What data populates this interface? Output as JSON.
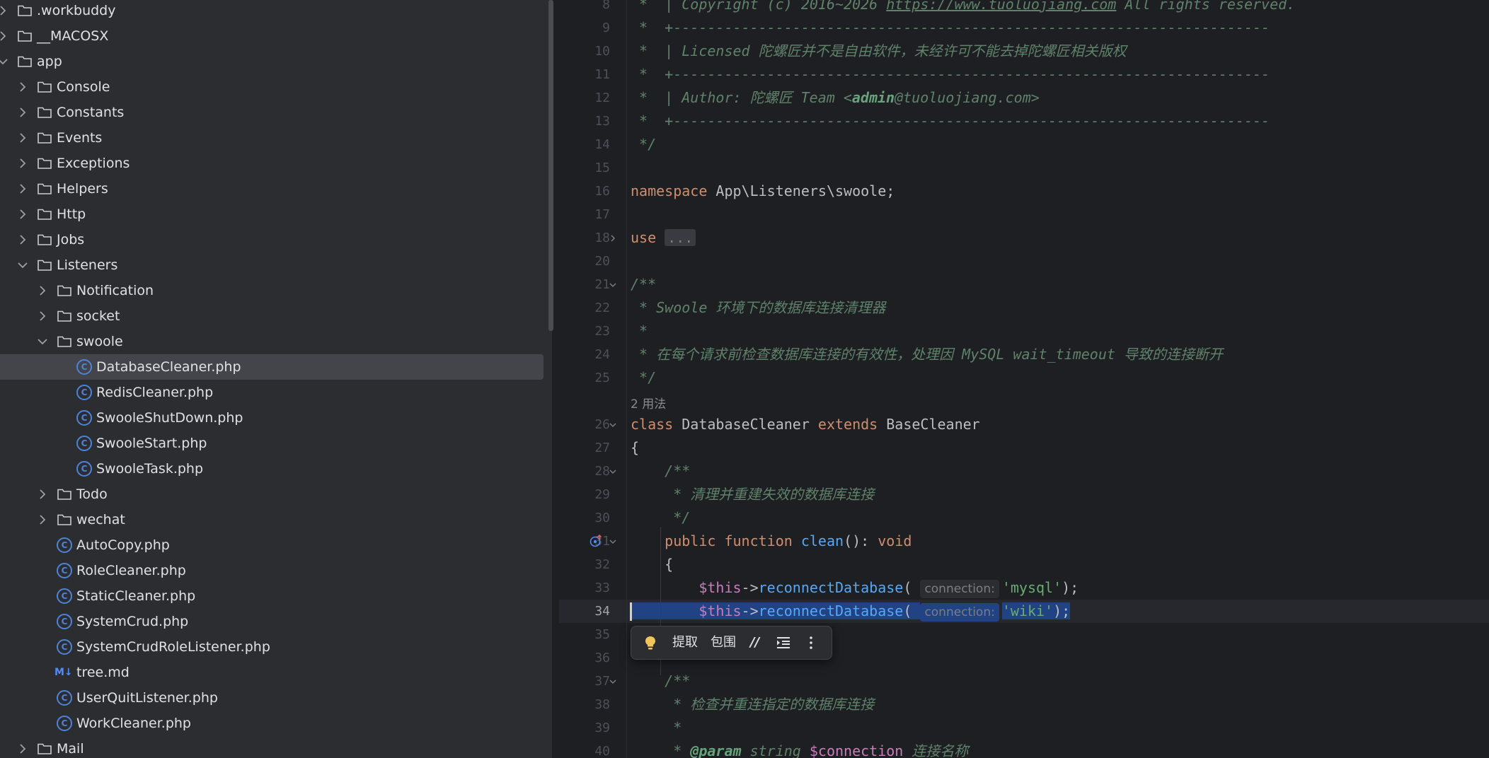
{
  "project_tree": {
    "items": [
      {
        "label": ".workbuddy",
        "type": "folder",
        "expanded": false,
        "depth": 0
      },
      {
        "label": "__MACOSX",
        "type": "folder",
        "expanded": false,
        "depth": 0
      },
      {
        "label": "app",
        "type": "folder",
        "expanded": true,
        "depth": 0
      },
      {
        "label": "Console",
        "type": "folder",
        "expanded": false,
        "depth": 1
      },
      {
        "label": "Constants",
        "type": "folder",
        "expanded": false,
        "depth": 1
      },
      {
        "label": "Events",
        "type": "folder",
        "expanded": false,
        "depth": 1
      },
      {
        "label": "Exceptions",
        "type": "folder",
        "expanded": false,
        "depth": 1
      },
      {
        "label": "Helpers",
        "type": "folder",
        "expanded": false,
        "depth": 1
      },
      {
        "label": "Http",
        "type": "folder",
        "expanded": false,
        "depth": 1
      },
      {
        "label": "Jobs",
        "type": "folder",
        "expanded": false,
        "depth": 1
      },
      {
        "label": "Listeners",
        "type": "folder",
        "expanded": true,
        "depth": 1
      },
      {
        "label": "Notification",
        "type": "folder",
        "expanded": false,
        "depth": 2
      },
      {
        "label": "socket",
        "type": "folder",
        "expanded": false,
        "depth": 2
      },
      {
        "label": "swoole",
        "type": "folder",
        "expanded": true,
        "depth": 2
      },
      {
        "label": "DatabaseCleaner.php",
        "type": "class",
        "depth": 3,
        "selected": true
      },
      {
        "label": "RedisCleaner.php",
        "type": "class",
        "depth": 3
      },
      {
        "label": "SwooleShutDown.php",
        "type": "class",
        "depth": 3
      },
      {
        "label": "SwooleStart.php",
        "type": "class",
        "depth": 3
      },
      {
        "label": "SwooleTask.php",
        "type": "class",
        "depth": 3
      },
      {
        "label": "Todo",
        "type": "folder",
        "expanded": false,
        "depth": 2
      },
      {
        "label": "wechat",
        "type": "folder",
        "expanded": false,
        "depth": 2
      },
      {
        "label": "AutoCopy.php",
        "type": "class",
        "depth": 2
      },
      {
        "label": "RoleCleaner.php",
        "type": "class",
        "depth": 2
      },
      {
        "label": "StaticCleaner.php",
        "type": "class",
        "depth": 2
      },
      {
        "label": "SystemCrud.php",
        "type": "class",
        "depth": 2
      },
      {
        "label": "SystemCrudRoleListener.php",
        "type": "class",
        "depth": 2
      },
      {
        "label": "tree.md",
        "type": "markdown",
        "depth": 2
      },
      {
        "label": "UserQuitListener.php",
        "type": "class",
        "depth": 2
      },
      {
        "label": "WorkCleaner.php",
        "type": "class",
        "depth": 2
      },
      {
        "label": "Mail",
        "type": "folder",
        "expanded": false,
        "depth": 1
      }
    ]
  },
  "editor": {
    "current_line": "34",
    "usages_label": "2 用法",
    "lines": [
      {
        "num": "8",
        "tokens": [
          {
            "t": " *  | Copyright (c) 2016~2026 ",
            "c": "cm"
          },
          {
            "t": "https://www.tuoluojiang.com",
            "c": "lnk"
          },
          {
            "t": " All rights reserved.",
            "c": "cm"
          }
        ]
      },
      {
        "num": "9",
        "tokens": [
          {
            "t": " *  +----------------------------------------------------------------------",
            "c": "cm"
          }
        ]
      },
      {
        "num": "10",
        "tokens": [
          {
            "t": " *  | Licensed 陀螺匠并不是自由软件，未经许可不能去掉陀螺匠相关版权",
            "c": "cm"
          }
        ]
      },
      {
        "num": "11",
        "tokens": [
          {
            "t": " *  +----------------------------------------------------------------------",
            "c": "cm"
          }
        ]
      },
      {
        "num": "12",
        "tokens": [
          {
            "t": " *  | Author: 陀螺匠 Team <",
            "c": "cm"
          },
          {
            "t": "admin",
            "c": "tagb"
          },
          {
            "t": "@tuoluojiang.com>",
            "c": "cm"
          }
        ]
      },
      {
        "num": "13",
        "tokens": [
          {
            "t": " *  +----------------------------------------------------------------------",
            "c": "cm"
          }
        ]
      },
      {
        "num": "14",
        "tokens": [
          {
            "t": " */",
            "c": "cm"
          }
        ]
      },
      {
        "num": "15",
        "tokens": []
      },
      {
        "num": "16",
        "tokens": [
          {
            "t": "namespace",
            "c": "kw"
          },
          {
            "t": " App\\Listeners\\swoole;",
            "c": ""
          }
        ]
      },
      {
        "num": "17",
        "tokens": []
      },
      {
        "num": "18",
        "fold": "closed",
        "tokens": [
          {
            "t": "use",
            "c": "kw"
          },
          {
            "t": " ",
            "c": ""
          },
          {
            "t": "...",
            "c": "ellipsis"
          }
        ]
      },
      {
        "num": "20",
        "tokens": []
      },
      {
        "num": "21",
        "fold": "open",
        "tokens": [
          {
            "t": "/**",
            "c": "cm"
          }
        ]
      },
      {
        "num": "22",
        "tokens": [
          {
            "t": " * Swoole 环境下的数据库连接清理器",
            "c": "cm"
          }
        ]
      },
      {
        "num": "23",
        "tokens": [
          {
            "t": " *",
            "c": "cm"
          }
        ]
      },
      {
        "num": "24",
        "tokens": [
          {
            "t": " * 在每个请求前检查数据库连接的有效性，处理因 MySQL wait_timeout 导致的连接断开",
            "c": "cm"
          }
        ]
      },
      {
        "num": "25",
        "tokens": [
          {
            "t": " */",
            "c": "cm"
          }
        ]
      },
      {
        "num": "",
        "usage": true,
        "tokens": []
      },
      {
        "num": "26",
        "fold": "open",
        "tokens": [
          {
            "t": "class",
            "c": "kw"
          },
          {
            "t": " DatabaseCleaner ",
            "c": ""
          },
          {
            "t": "extends",
            "c": "kw"
          },
          {
            "t": " BaseCleaner",
            "c": ""
          }
        ]
      },
      {
        "num": "27",
        "tokens": [
          {
            "t": "{",
            "c": ""
          }
        ]
      },
      {
        "num": "28",
        "fold": "open",
        "tokens": [
          {
            "t": "    /**",
            "c": "cm"
          }
        ]
      },
      {
        "num": "29",
        "tokens": [
          {
            "t": "     * 清理并重建失效的数据库连接",
            "c": "cm"
          }
        ]
      },
      {
        "num": "30",
        "tokens": [
          {
            "t": "     */",
            "c": "cm"
          }
        ]
      },
      {
        "num": "31",
        "fold": "open",
        "override": true,
        "tokens": [
          {
            "t": "    ",
            "c": ""
          },
          {
            "t": "public function",
            "c": "kw"
          },
          {
            "t": " ",
            "c": ""
          },
          {
            "t": "clean",
            "c": "fn"
          },
          {
            "t": "(): ",
            "c": ""
          },
          {
            "t": "void",
            "c": "kw"
          }
        ]
      },
      {
        "num": "32",
        "tokens": [
          {
            "t": "    {",
            "c": ""
          }
        ]
      },
      {
        "num": "33",
        "tokens": [
          {
            "t": "        ",
            "c": ""
          },
          {
            "t": "$this",
            "c": "var"
          },
          {
            "t": "->",
            "c": ""
          },
          {
            "t": "reconnectDatabase",
            "c": "fn"
          },
          {
            "t": "( ",
            "c": ""
          },
          {
            "t": "connection:",
            "c": "hint"
          },
          {
            "t": "'mysql'",
            "c": "str"
          },
          {
            "t": ");",
            "c": ""
          }
        ]
      },
      {
        "num": "34",
        "selected": true,
        "tokens": [
          {
            "t": "        ",
            "c": ""
          },
          {
            "t": "$this",
            "c": "var"
          },
          {
            "t": "->",
            "c": ""
          },
          {
            "t": "reconnectDatabase",
            "c": "fn"
          },
          {
            "t": "( ",
            "c": ""
          },
          {
            "t": "connection:",
            "c": "hint"
          },
          {
            "t": "'wiki'",
            "c": "str"
          },
          {
            "t": ");",
            "c": ""
          }
        ]
      },
      {
        "num": "35",
        "tokens": []
      },
      {
        "num": "36",
        "tokens": []
      },
      {
        "num": "37",
        "fold": "open",
        "tokens": [
          {
            "t": "    /**",
            "c": "cm"
          }
        ]
      },
      {
        "num": "38",
        "tokens": [
          {
            "t": "     * 检查并重连指定的数据库连接",
            "c": "cm"
          }
        ]
      },
      {
        "num": "39",
        "tokens": [
          {
            "t": "     *",
            "c": "cm"
          }
        ]
      },
      {
        "num": "40",
        "tokens": [
          {
            "t": "     * ",
            "c": "cm"
          },
          {
            "t": "@param",
            "c": "tagb"
          },
          {
            "t": " string ",
            "c": "tagc"
          },
          {
            "t": "$connection",
            "c": "var"
          },
          {
            "t": " 连接名称",
            "c": "cm"
          }
        ]
      }
    ]
  },
  "popup": {
    "extract_label": "提取",
    "surround_label": "包围",
    "comment_glyph": "//",
    "icon_names": [
      "lightbulb-icon",
      "comment-icon",
      "indent-icon",
      "more-icon"
    ]
  }
}
